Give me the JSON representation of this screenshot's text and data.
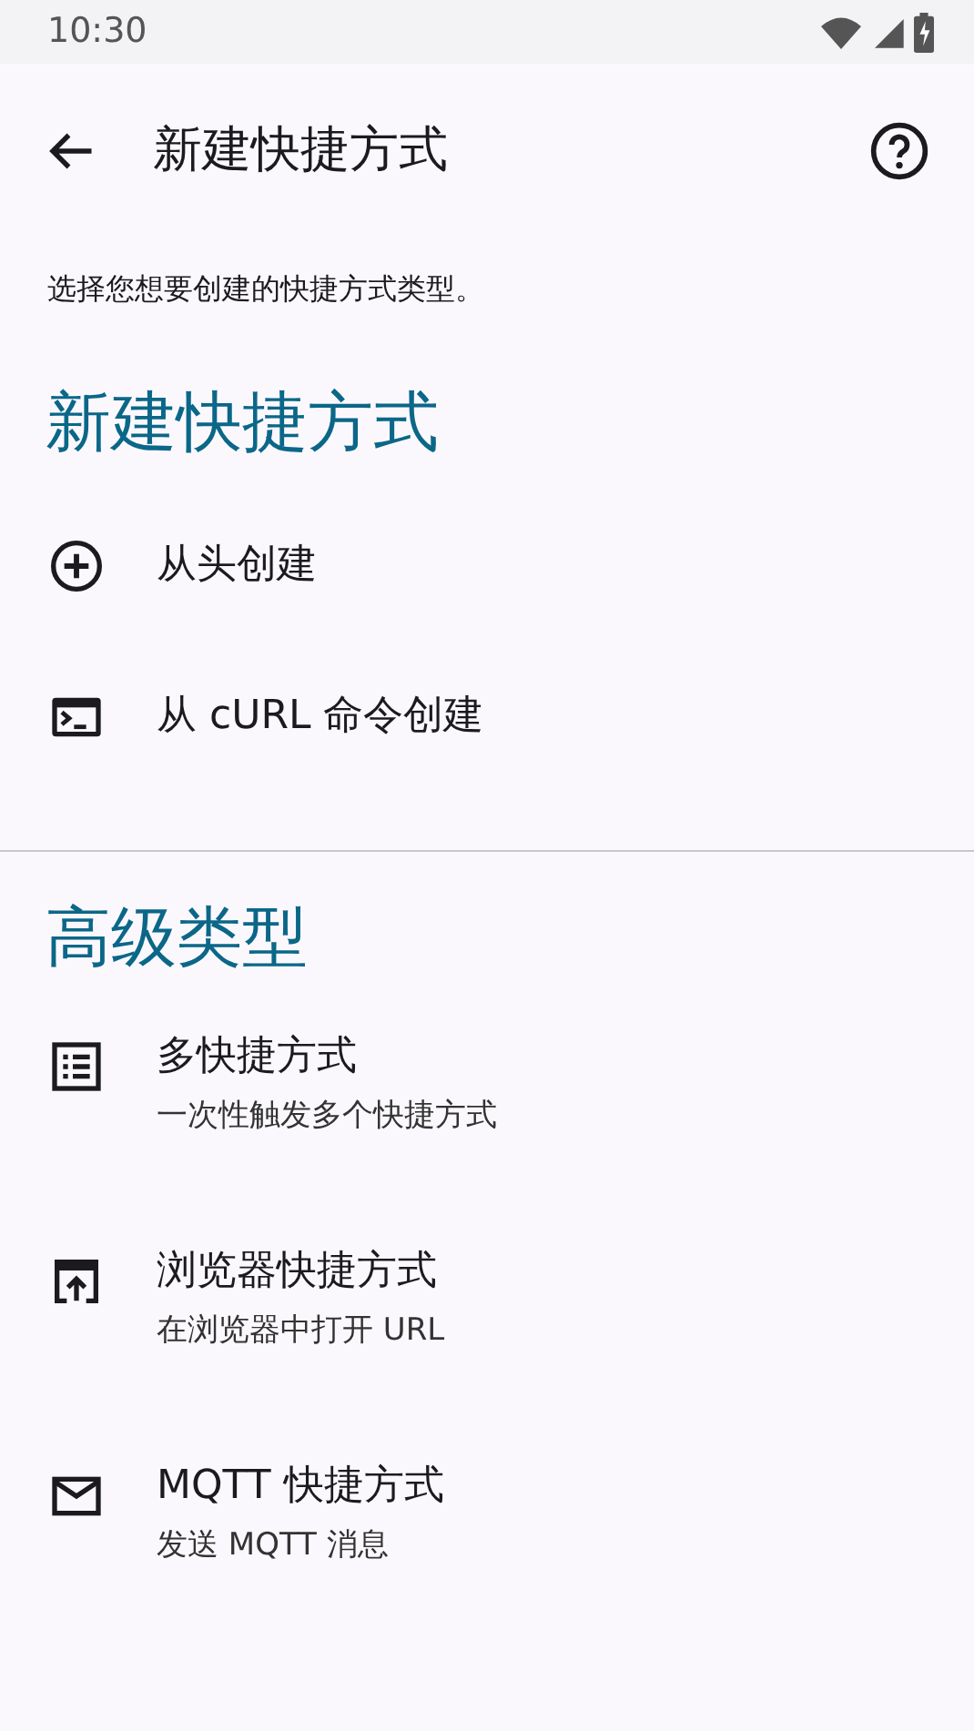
{
  "status_bar": {
    "time": "10:30"
  },
  "app_bar": {
    "title": "新建快捷方式"
  },
  "description": "选择您想要创建的快捷方式类型。",
  "sections": [
    {
      "title": "新建快捷方式",
      "items": [
        {
          "title": "从头创建"
        },
        {
          "title": "从 cURL 命令创建"
        }
      ]
    },
    {
      "title": "高级类型",
      "items": [
        {
          "title": "多快捷方式",
          "subtitle": "一次性触发多个快捷方式"
        },
        {
          "title": "浏览器快捷方式",
          "subtitle": "在浏览器中打开 URL"
        },
        {
          "title": "MQTT 快捷方式",
          "subtitle": "发送 MQTT 消息"
        }
      ]
    }
  ]
}
